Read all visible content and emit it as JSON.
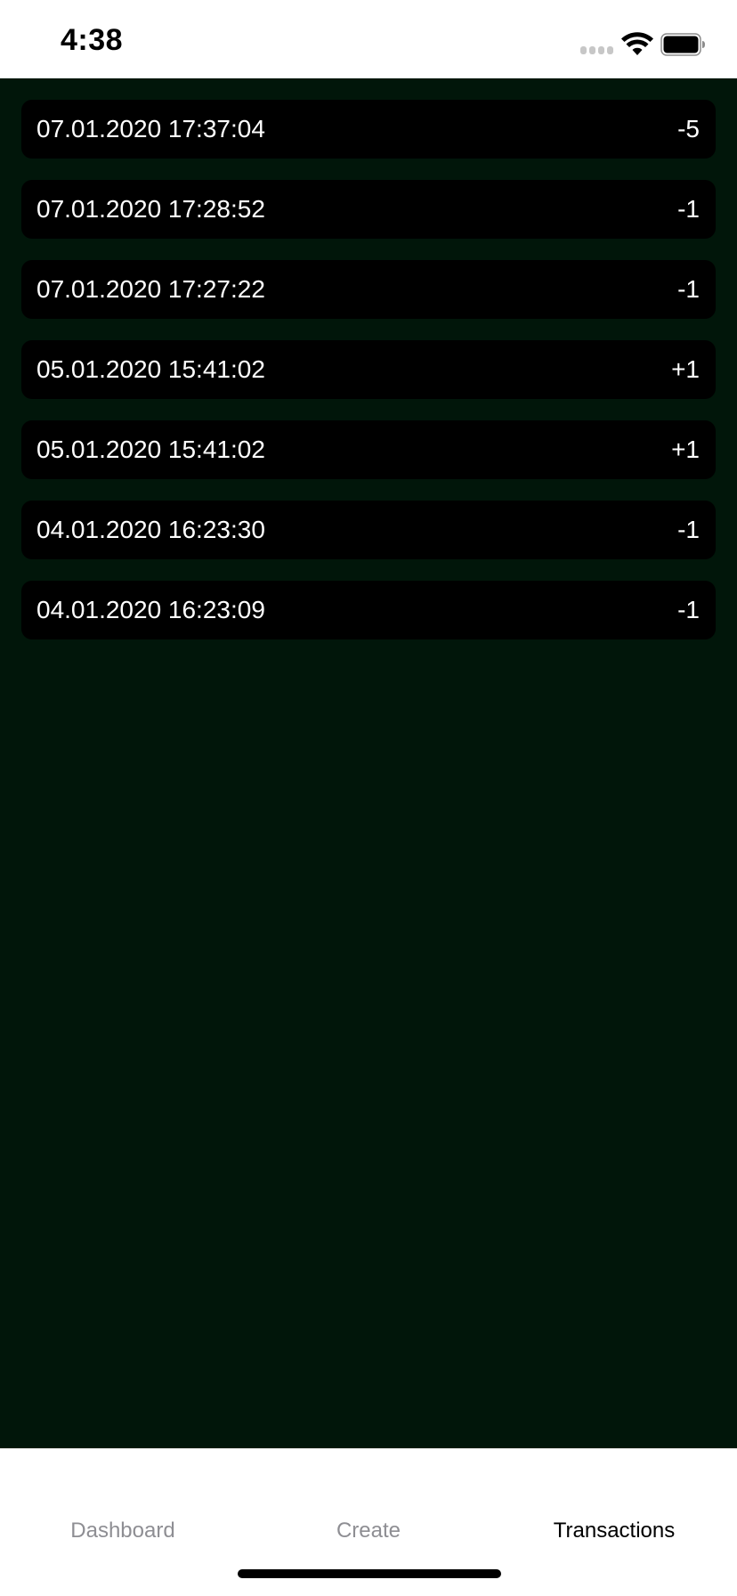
{
  "status_bar": {
    "time": "4:38",
    "icons": [
      "cellular-signal-icon",
      "wifi-icon",
      "battery-icon"
    ]
  },
  "transactions": [
    {
      "date": "07.01.2020 17:37:04",
      "amount": "-5"
    },
    {
      "date": "07.01.2020 17:28:52",
      "amount": "-1"
    },
    {
      "date": "07.01.2020 17:27:22",
      "amount": "-1"
    },
    {
      "date": "05.01.2020 15:41:02",
      "amount": "+1"
    },
    {
      "date": "05.01.2020 15:41:02",
      "amount": "+1"
    },
    {
      "date": "04.01.2020 16:23:30",
      "amount": "-1"
    },
    {
      "date": "04.01.2020 16:23:09",
      "amount": "-1"
    }
  ],
  "tab_bar": {
    "tabs": [
      {
        "label": "Dashboard",
        "active": false
      },
      {
        "label": "Create",
        "active": false
      },
      {
        "label": "Transactions",
        "active": true
      }
    ]
  },
  "colors": {
    "background": "#01160a",
    "row_background": "#000000",
    "row_text": "#ffffff",
    "tab_inactive": "#8e8e93",
    "tab_active": "#000000"
  }
}
